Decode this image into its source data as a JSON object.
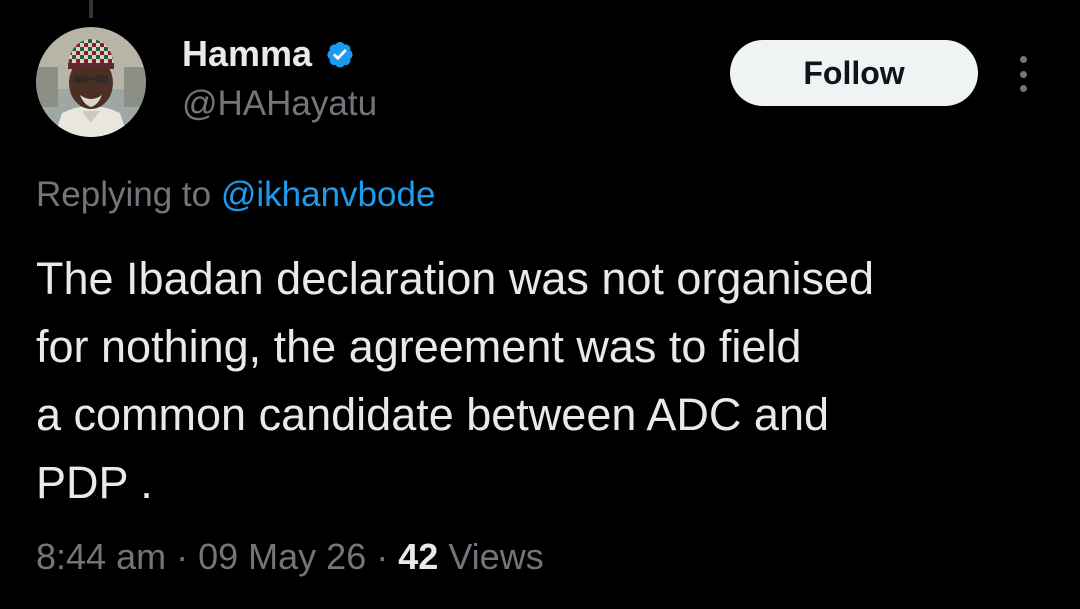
{
  "tweet": {
    "author": {
      "display_name": "Hamma",
      "handle": "@HAHayatu",
      "verified": true,
      "avatar_icon": "user-avatar-photo"
    },
    "follow_label": "Follow",
    "more_icon": "more-vertical-icon",
    "reply": {
      "prefix": "Replying to",
      "mention": "@ikhanvbode"
    },
    "text": "The Ibadan declaration was not organised\nfor nothing, the agreement was to field\na common candidate between ADC and\nPDP .",
    "meta": {
      "time": "8:44 am",
      "separator": "·",
      "date": "09 May 26",
      "views_count": "42",
      "views_label": "Views"
    }
  },
  "colors": {
    "background": "#000000",
    "primary_text": "#e7e9ea",
    "secondary_text": "#71767b",
    "link": "#1d9bf0",
    "verified_badge": "#1d9bf0",
    "follow_button_bg": "#eff3f4",
    "follow_button_text": "#0f1419"
  }
}
